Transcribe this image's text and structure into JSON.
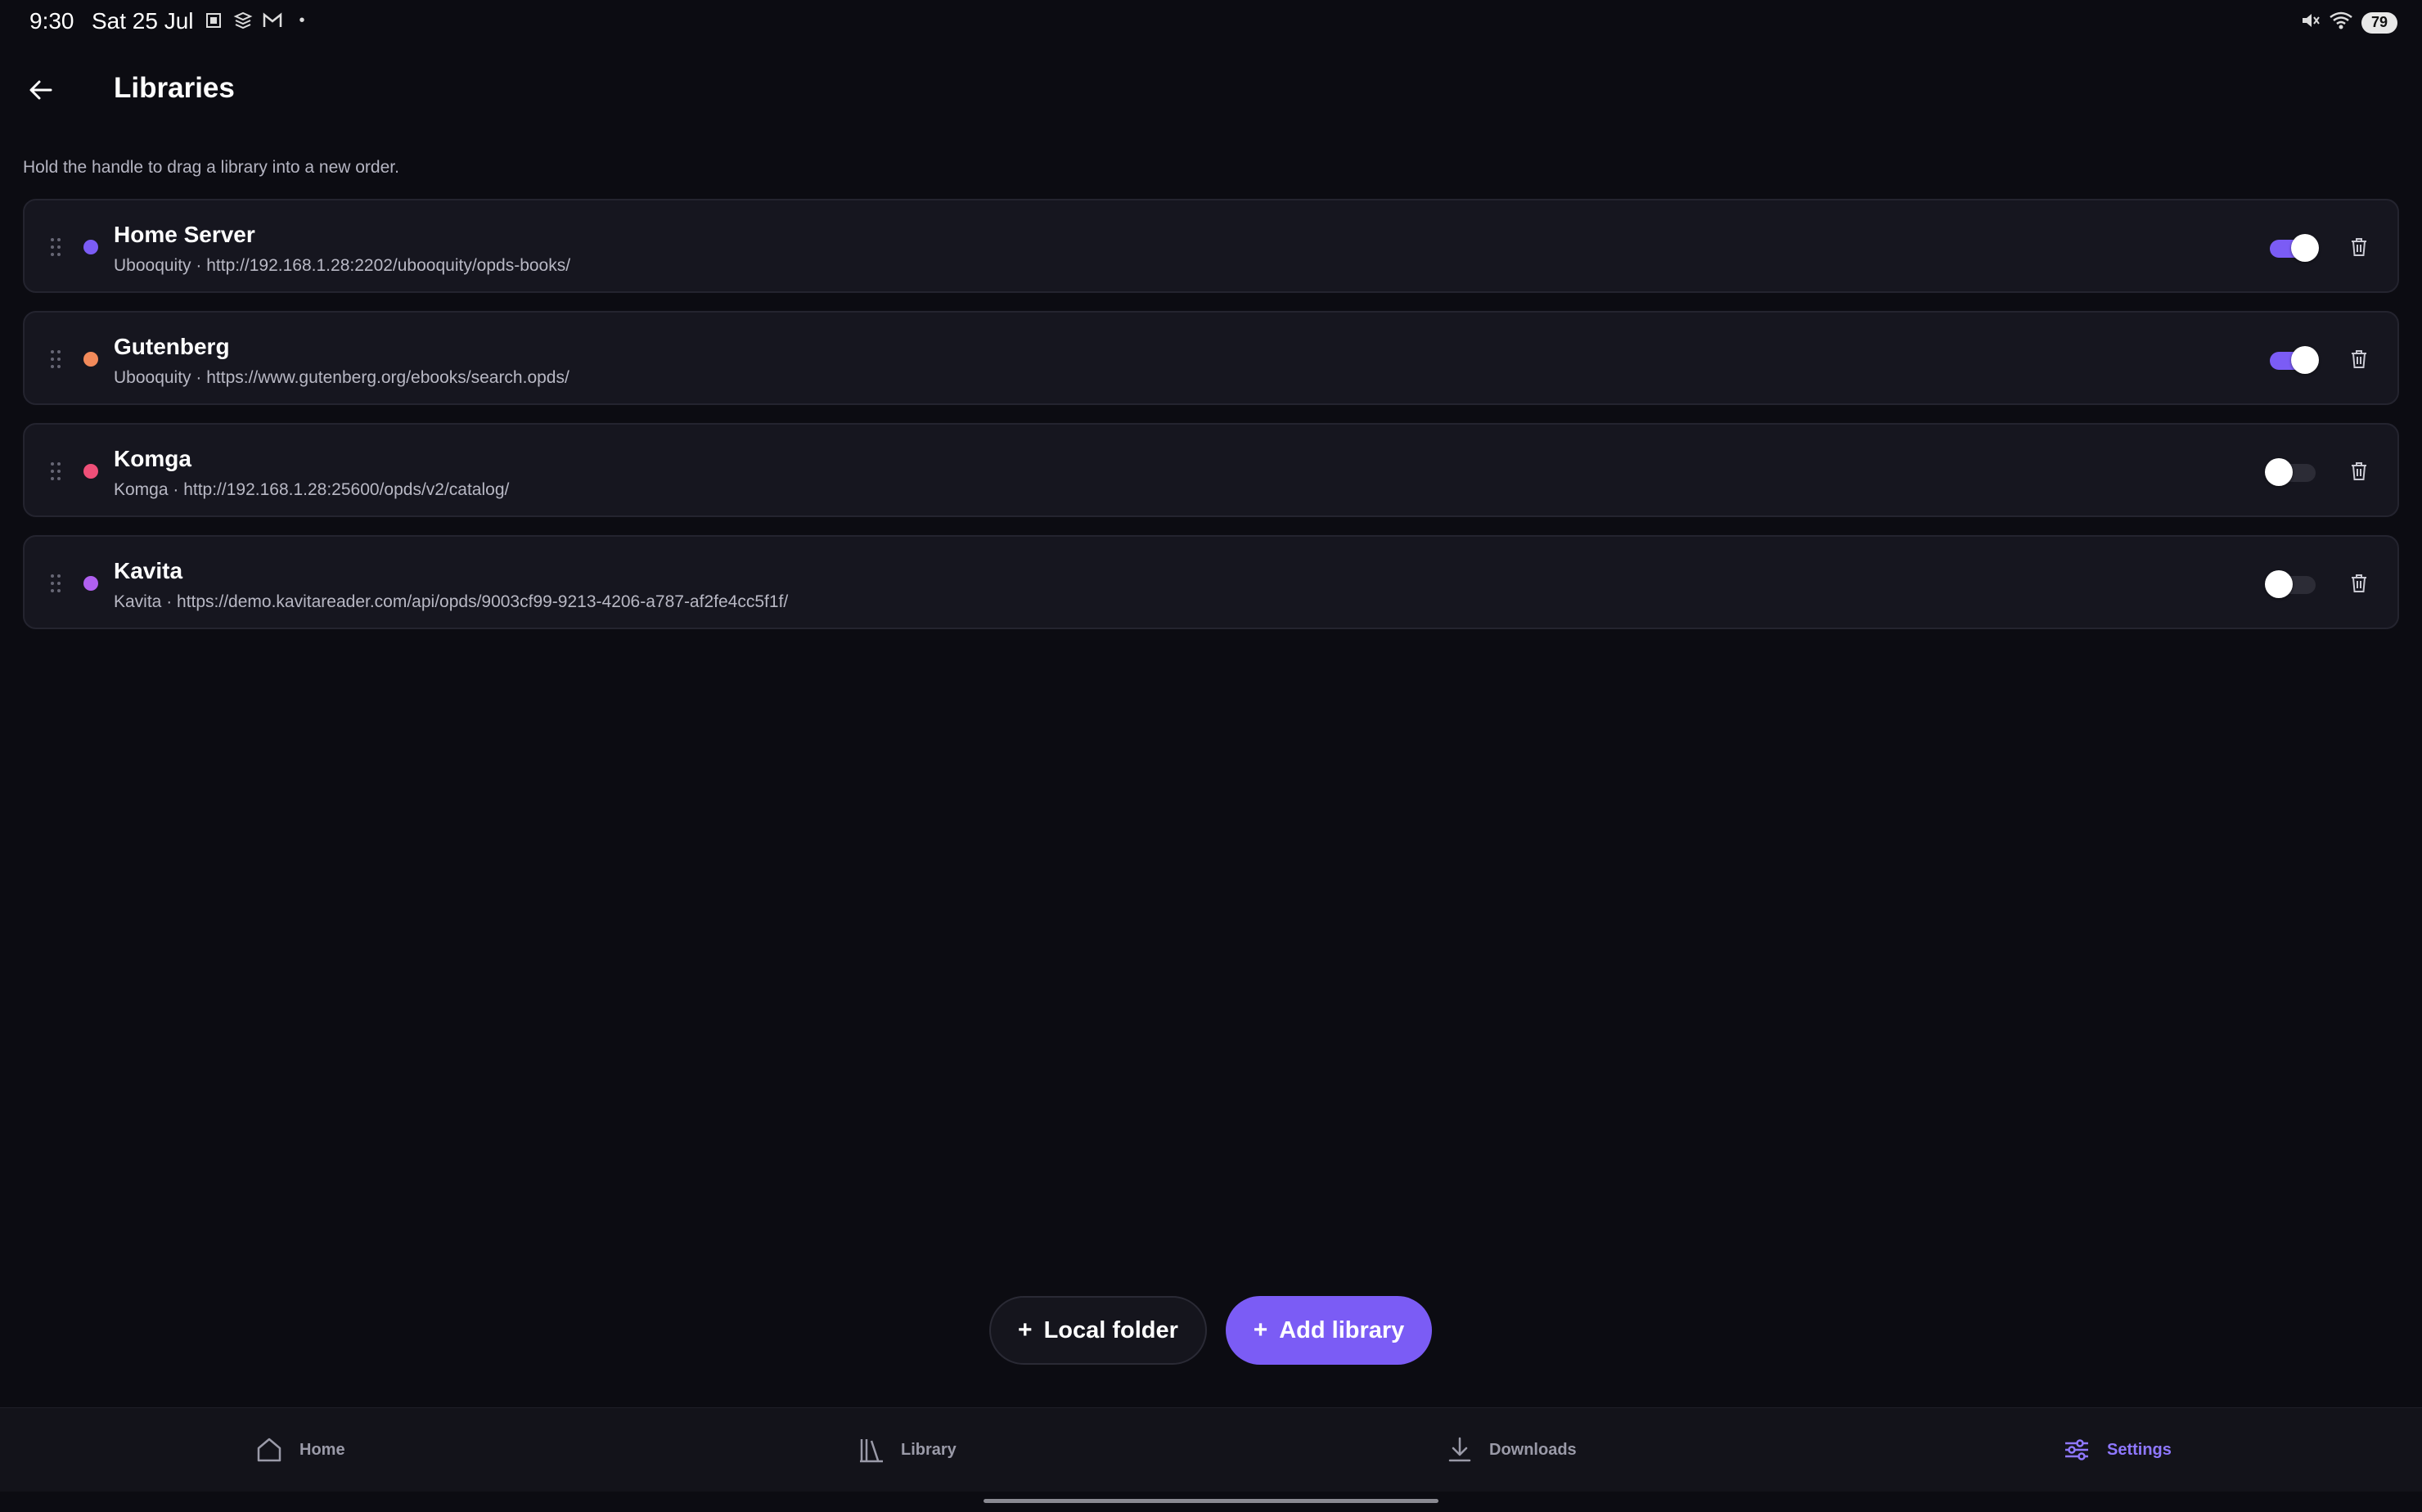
{
  "status_bar": {
    "time": "9:30",
    "date": "Sat 25 Jul",
    "battery": "79"
  },
  "app_bar": {
    "title": "Libraries"
  },
  "hint": "Hold the handle to drag a library into a new order.",
  "libraries": [
    {
      "name": "Home Server",
      "subtitle": "Ubooquity · http://192.168.1.28:2202/ubooquity/opds-books/",
      "color": "#7b5cf5",
      "enabled": true
    },
    {
      "name": "Gutenberg",
      "subtitle": "Ubooquity · https://www.gutenberg.org/ebooks/search.opds/",
      "color": "#f28a5a",
      "enabled": true
    },
    {
      "name": "Komga",
      "subtitle": "Komga · http://192.168.1.28:25600/opds/v2/catalog/",
      "color": "#ef4f78",
      "enabled": false
    },
    {
      "name": "Kavita",
      "subtitle": "Kavita · https://demo.kavitareader.com/api/opds/9003cf99-9213-4206-a787-af2fe4cc5f1f/",
      "color": "#b060f0",
      "enabled": false
    }
  ],
  "actions": {
    "local_folder": "Local folder",
    "add_library": "Add library"
  },
  "nav": {
    "home": "Home",
    "library": "Library",
    "downloads": "Downloads",
    "settings": "Settings",
    "active": "settings"
  },
  "colors": {
    "accent": "#7b5cf5",
    "background": "#0c0c12",
    "card": "#16161f"
  }
}
